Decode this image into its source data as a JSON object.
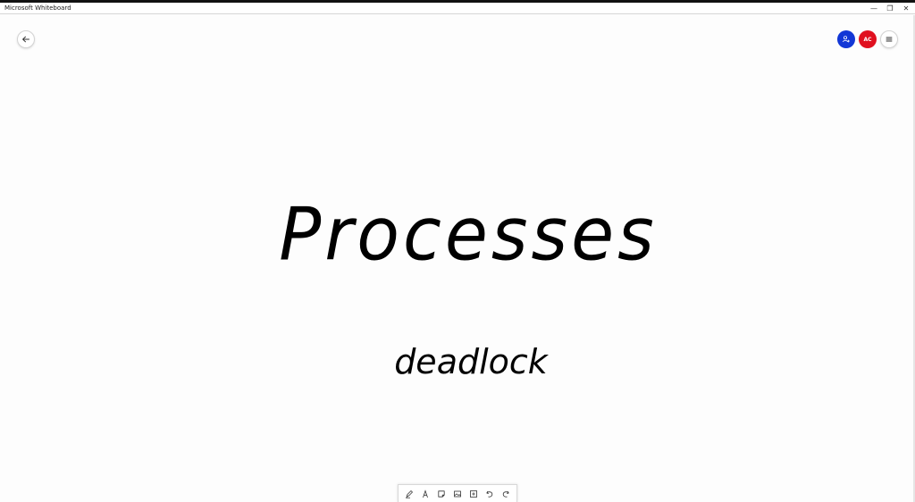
{
  "window": {
    "title": "Microsoft Whiteboard",
    "controls": {
      "minimize": "—",
      "maximize": "❐",
      "close": "✕"
    }
  },
  "header": {
    "back_icon": "arrow-left-icon",
    "invite_icon": "person-add-icon",
    "avatar_initials": "AC",
    "menu_icon": "hamburger-icon"
  },
  "board": {
    "title_text": "Processes",
    "subtitle_text": "deadlock"
  },
  "toolbar": {
    "tools": [
      "pen-icon",
      "text-icon",
      "sticky-note-icon",
      "image-icon",
      "insert-icon",
      "undo-icon",
      "redo-icon"
    ]
  },
  "colors": {
    "invite_button": "#1237d6",
    "avatar": "#e0101f",
    "ink": "#000000"
  }
}
